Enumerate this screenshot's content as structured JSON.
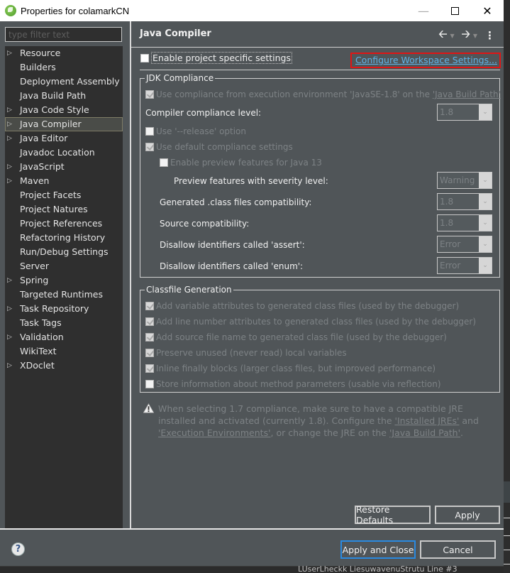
{
  "window": {
    "title": "Properties for colamarkCN",
    "minimize_icon": "minimize-icon",
    "maximize_icon": "maximize-icon",
    "close_icon": "close-icon"
  },
  "filter": {
    "placeholder": "type filter text",
    "value": ""
  },
  "nav": {
    "items": [
      {
        "label": "Resource",
        "expandable": true
      },
      {
        "label": "Builders",
        "expandable": false
      },
      {
        "label": "Deployment Assembly",
        "expandable": false
      },
      {
        "label": "Java Build Path",
        "expandable": false
      },
      {
        "label": "Java Code Style",
        "expandable": true
      },
      {
        "label": "Java Compiler",
        "expandable": true,
        "selected": true
      },
      {
        "label": "Java Editor",
        "expandable": true
      },
      {
        "label": "Javadoc Location",
        "expandable": false
      },
      {
        "label": "JavaScript",
        "expandable": true
      },
      {
        "label": "Maven",
        "expandable": true
      },
      {
        "label": "Project Facets",
        "expandable": false
      },
      {
        "label": "Project Natures",
        "expandable": false
      },
      {
        "label": "Project References",
        "expandable": false
      },
      {
        "label": "Refactoring History",
        "expandable": false
      },
      {
        "label": "Run/Debug Settings",
        "expandable": false
      },
      {
        "label": "Server",
        "expandable": false
      },
      {
        "label": "Spring",
        "expandable": true
      },
      {
        "label": "Targeted Runtimes",
        "expandable": false
      },
      {
        "label": "Task Repository",
        "expandable": true
      },
      {
        "label": "Task Tags",
        "expandable": false
      },
      {
        "label": "Validation",
        "expandable": true
      },
      {
        "label": "WikiText",
        "expandable": false
      },
      {
        "label": "XDoclet",
        "expandable": true
      }
    ]
  },
  "page": {
    "title": "Java Compiler",
    "enable_project_settings": {
      "label": "Enable project specific settings",
      "checked": false
    },
    "configure_workspace_link": "Configure Workspace Settings...",
    "jdk_group": {
      "title": "JDK Compliance",
      "use_ee_compliance_prefix": "Use compliance from execution environment 'JavaSE-1.8' on the ",
      "use_ee_compliance_link": "'Java Build Path'",
      "use_ee_compliance_checked": true,
      "compliance_level_label": "Compiler compliance level:",
      "compliance_level_value": "1.8",
      "release_option_label": "Use '--release' option",
      "release_option_checked": false,
      "default_compliance_label": "Use default compliance settings",
      "default_compliance_checked": true,
      "preview_features_label": "Enable preview features for Java 13",
      "preview_features_checked": false,
      "preview_severity_label": "Preview features with severity level:",
      "preview_severity_value": "Warning",
      "generated_class_label": "Generated .class files compatibility:",
      "generated_class_value": "1.8",
      "source_compat_label": "Source compatibility:",
      "source_compat_value": "1.8",
      "assert_label": "Disallow identifiers called 'assert':",
      "assert_value": "Error",
      "enum_label": "Disallow identifiers called 'enum':",
      "enum_value": "Error"
    },
    "classfile_group": {
      "title": "Classfile Generation",
      "options": [
        {
          "label": "Add variable attributes to generated class files (used by the debugger)",
          "checked": true
        },
        {
          "label": "Add line number attributes to generated class files (used by the debugger)",
          "checked": true
        },
        {
          "label": "Add source file name to generated class file (used by the debugger)",
          "checked": true
        },
        {
          "label": "Preserve unused (never read) local variables",
          "checked": true
        },
        {
          "label": "Inline finally blocks (larger class files, but improved performance)",
          "checked": true
        },
        {
          "label": "Store information about method parameters (usable via reflection)",
          "checked": false
        }
      ]
    },
    "warning": {
      "text1": "When selecting 1.7 compliance, make sure to have a compatible JRE installed and activated (currently 1.8). Configure the ",
      "link1": "'Installed JREs'",
      "text2": " and ",
      "link2": "'Execution Environments'",
      "text3": ", or change the JRE on the ",
      "link3": "'Java Build Path'",
      "text4": "."
    },
    "restore_defaults": "Restore Defaults",
    "apply": "Apply"
  },
  "footer": {
    "apply_and_close": "Apply and Close",
    "cancel": "Cancel",
    "help_icon": "help-icon"
  },
  "background_text": "LUserLheckk   LiesuwavenuStrutu   Line #3"
}
